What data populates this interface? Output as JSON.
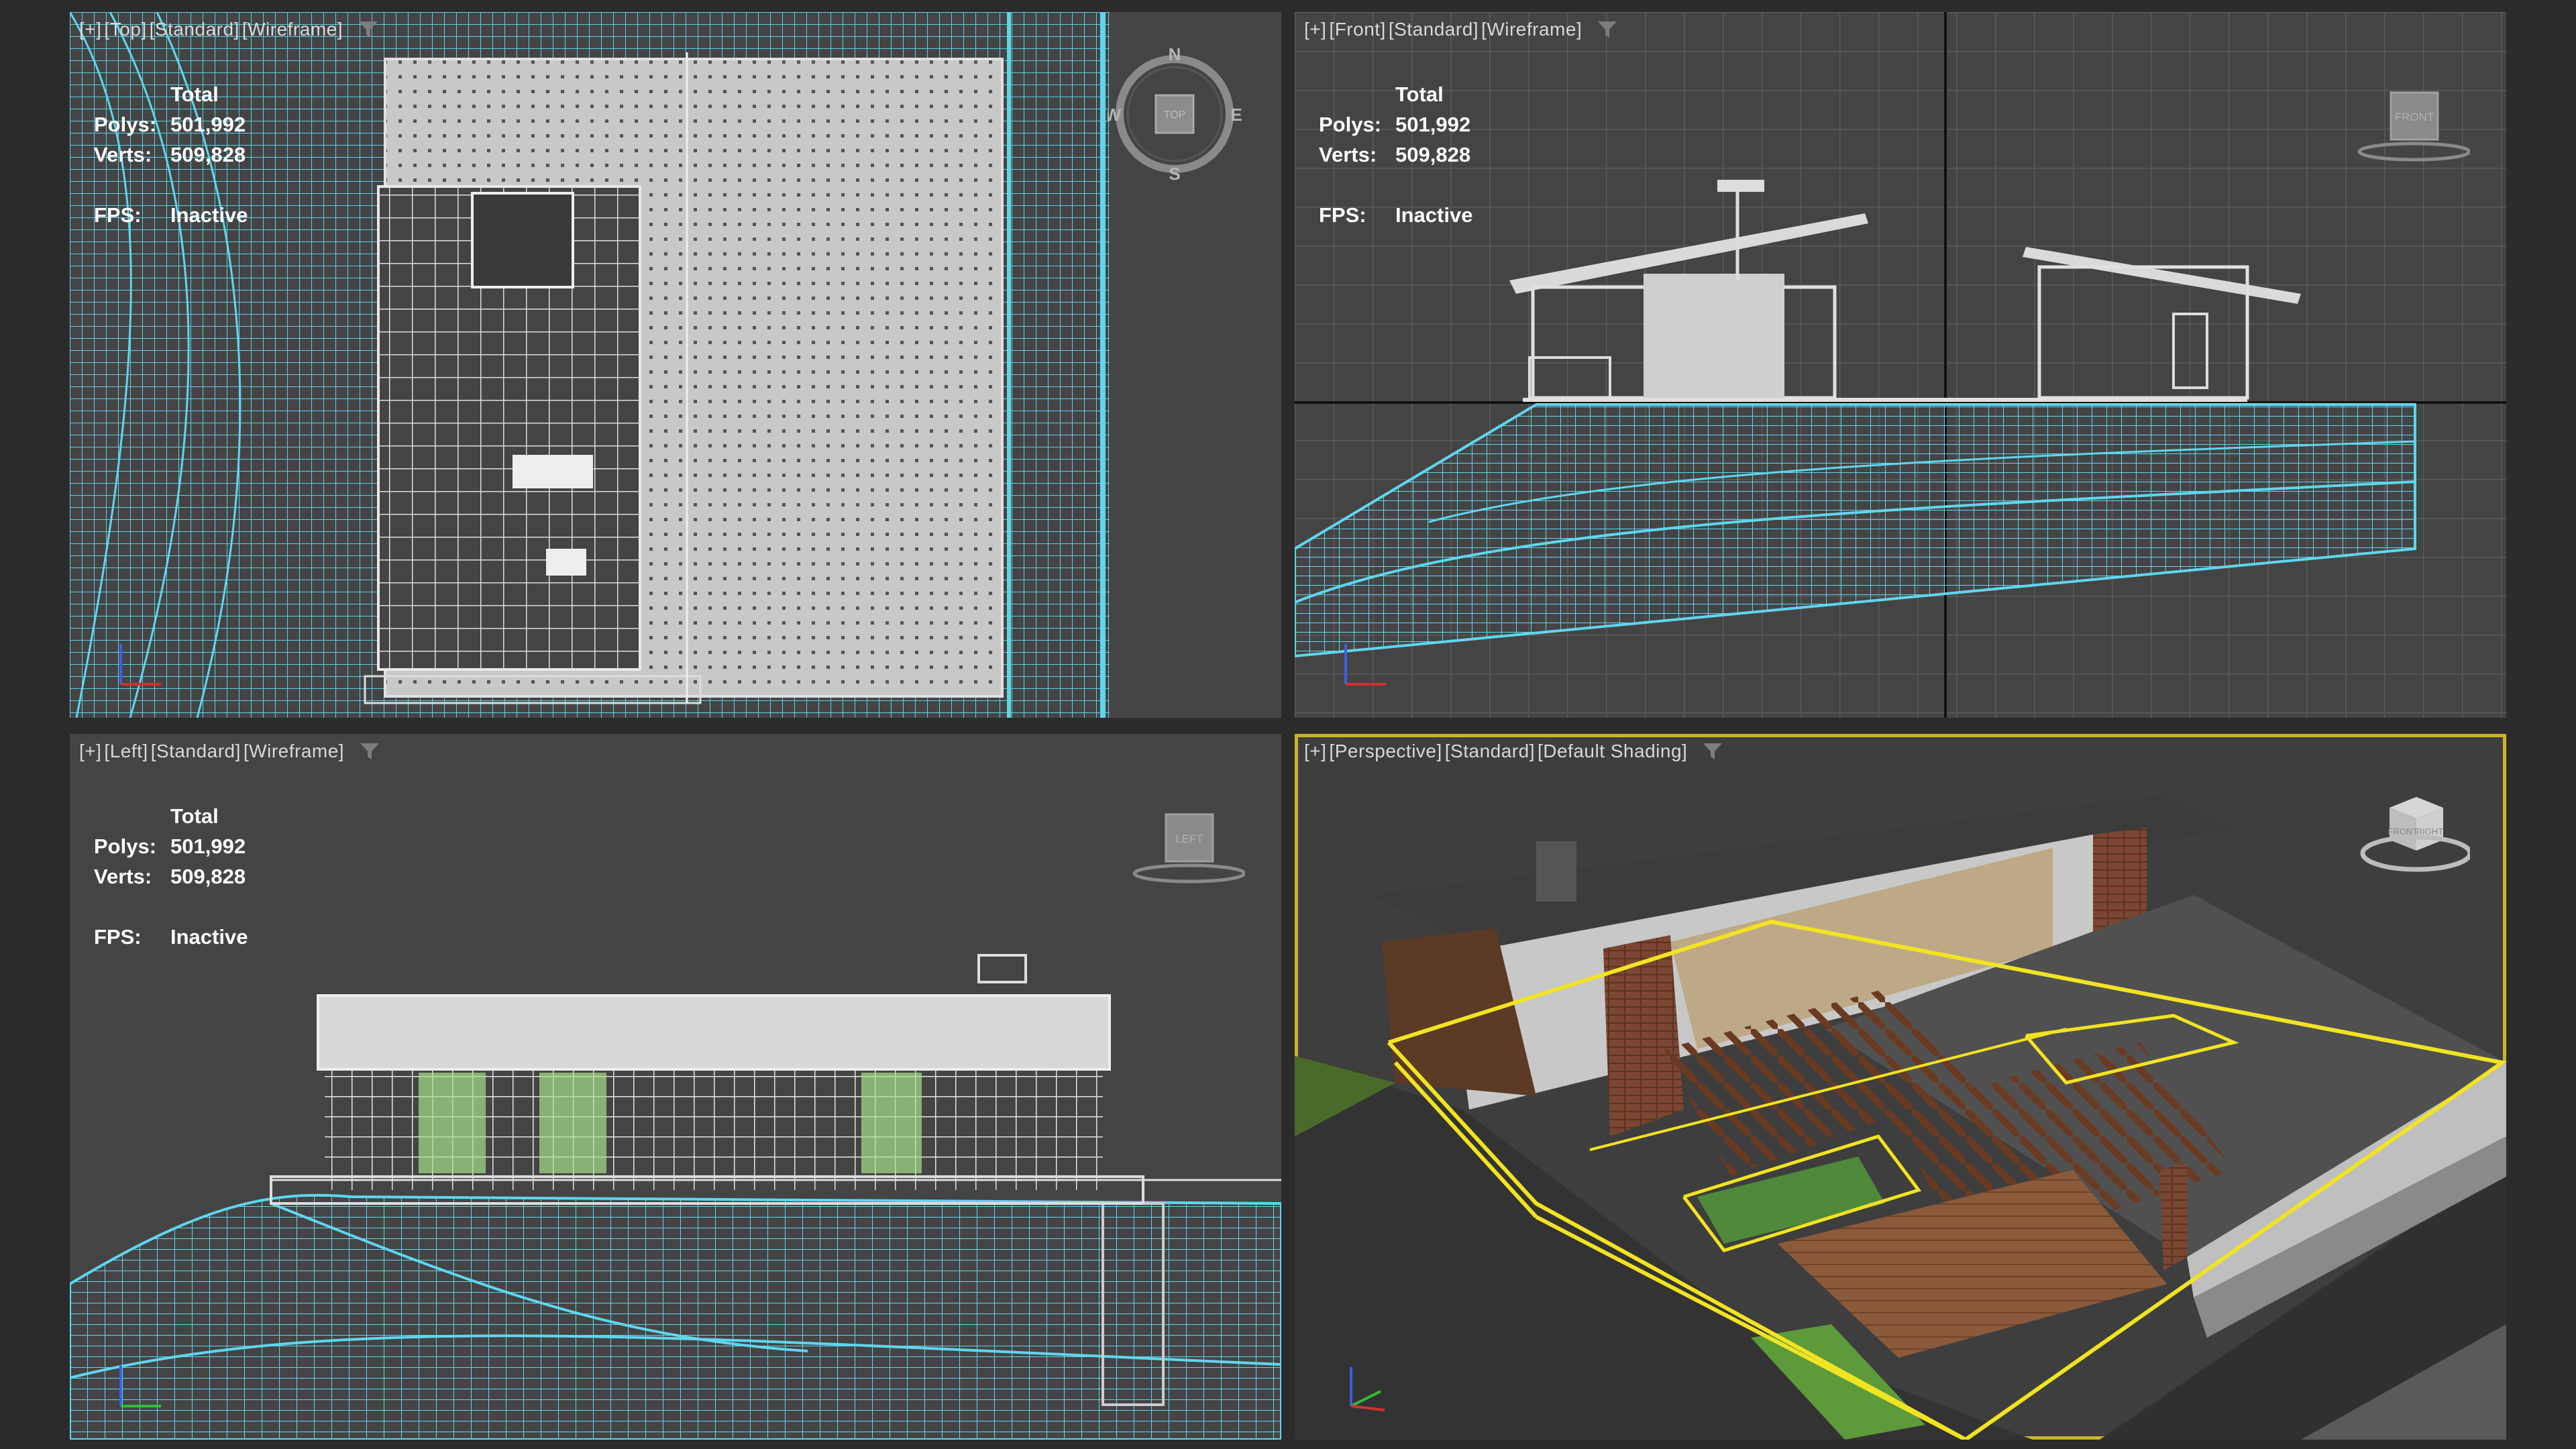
{
  "viewports": {
    "top": {
      "label_parts": [
        "[+]",
        "[Top]",
        "[Standard]",
        "[Wireframe]"
      ],
      "stats": {
        "header": "Total",
        "polys_label": "Polys:",
        "polys": "501,992",
        "verts_label": "Verts:",
        "verts": "509,828",
        "fps_label": "FPS:",
        "fps": "Inactive"
      },
      "compass": {
        "n": "N",
        "s": "S",
        "e": "E",
        "w": "W",
        "cube": "TOP"
      }
    },
    "front": {
      "label_parts": [
        "[+]",
        "[Front]",
        "[Standard]",
        "[Wireframe]"
      ],
      "stats": {
        "header": "Total",
        "polys_label": "Polys:",
        "polys": "501,992",
        "verts_label": "Verts:",
        "verts": "509,828",
        "fps_label": "FPS:",
        "fps": "Inactive"
      },
      "cube": "FRONT"
    },
    "left": {
      "label_parts": [
        "[+]",
        "[Left]",
        "[Standard]",
        "[Wireframe]"
      ],
      "stats": {
        "header": "Total",
        "polys_label": "Polys:",
        "polys": "501,992",
        "verts_label": "Verts:",
        "verts": "509,828",
        "fps_label": "FPS:",
        "fps": "Inactive"
      },
      "cube": "LEFT"
    },
    "perspective": {
      "label_parts": [
        "[+]",
        "[Perspective]",
        "[Standard]",
        "[Default Shading]"
      ],
      "cube_faces": [
        "FRONT",
        "RIGHT"
      ],
      "active": true
    }
  },
  "colors": {
    "viewport_bg": "#444444",
    "terrain_wire": "#5fd6ee",
    "model_wire": "#d9d9d9",
    "selection": "#f2e322",
    "active_border": "#c9b52a",
    "grid": "#5a5a5a"
  },
  "icons": [
    "filter-icon",
    "viewcube-icon",
    "compass-icon",
    "axis-tripod-icon"
  ]
}
